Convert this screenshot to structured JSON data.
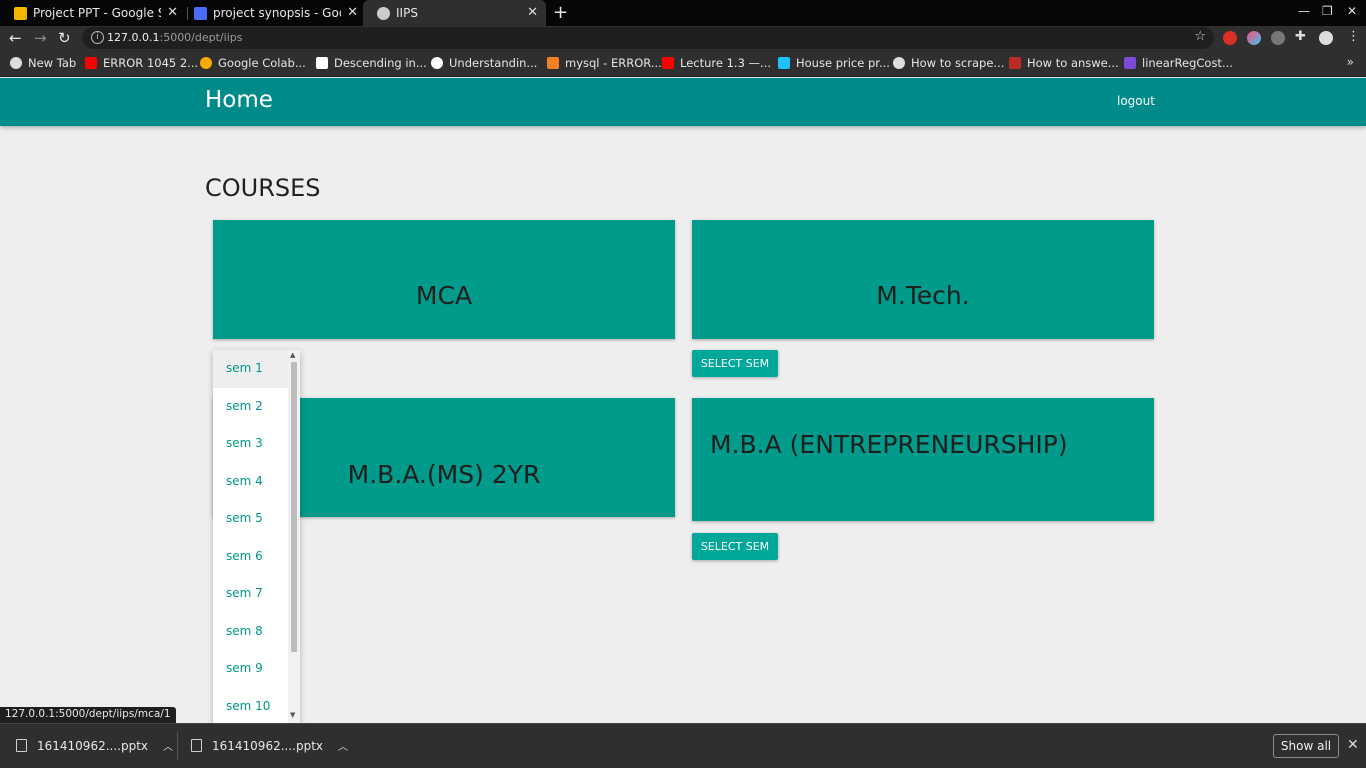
{
  "browser": {
    "tabs": [
      {
        "title": "Project PPT - Google Slides",
        "icon": "slides-icon",
        "color": "#f4b400"
      },
      {
        "title": "project synopsis - Google Docs",
        "icon": "docs-icon",
        "color": "#4a6cf7"
      },
      {
        "title": "IIPS",
        "icon": "globe-icon",
        "color": "#cccccc"
      }
    ],
    "url_host": "127.0.0.1",
    "url_rest": ":5000/dept/iips",
    "bookmarks": [
      {
        "label": "New Tab",
        "color": "#dddddd"
      },
      {
        "label": "ERROR 1045 2...",
        "color": "#ff0000"
      },
      {
        "label": "Google Colab...",
        "color": "#f9ab00"
      },
      {
        "label": "Descending in...",
        "color": "#ffffff"
      },
      {
        "label": "Understandin...",
        "color": "#ffffff"
      },
      {
        "label": "mysql - ERROR...",
        "color": "#f48024"
      },
      {
        "label": "Lecture 1.3 —...",
        "color": "#ff0000"
      },
      {
        "label": "House price pr...",
        "color": "#20beff"
      },
      {
        "label": "How to scrape...",
        "color": "#dddddd"
      },
      {
        "label": "How to answe...",
        "color": "#b92b27"
      },
      {
        "label": "linearRegCost...",
        "color": "#7b4bd6"
      }
    ]
  },
  "navbar": {
    "brand": "Home",
    "logout": "logout",
    "color": "#008b8b"
  },
  "main": {
    "heading": "COURSES",
    "courses": [
      {
        "name": "MCA"
      },
      {
        "name": "M.Tech.",
        "button": "SELECT SEM"
      },
      {
        "name": "M.B.A.(MS) 2YR"
      },
      {
        "name": "M.B.A (ENTREPRENEURSHIP)",
        "button": "SELECT SEM"
      }
    ],
    "card_color": "#009b8a",
    "button_color": "#00a89a"
  },
  "semester_dropdown": {
    "items": [
      "sem 1",
      "sem 2",
      "sem 3",
      "sem 4",
      "sem 5",
      "sem 6",
      "sem 7",
      "sem 8",
      "sem 9",
      "sem 10"
    ],
    "highlighted": "sem 1",
    "text_color": "#009688"
  },
  "status_url": "127.0.0.1:5000/dept/iips/mca/1",
  "downloads": {
    "items": [
      "161410962....pptx",
      "161410962....pptx"
    ],
    "show_all": "Show all"
  }
}
